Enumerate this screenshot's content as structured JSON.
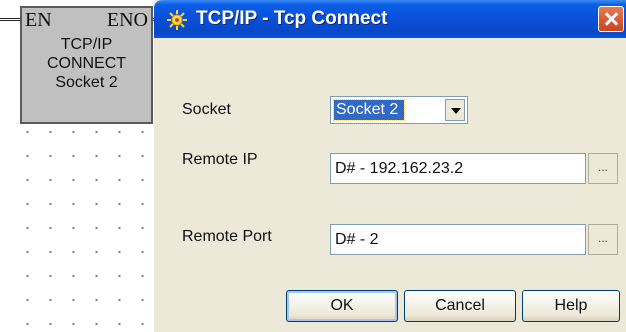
{
  "function_block": {
    "en_label": "EN",
    "eno_label": "ENO",
    "lines": [
      "TCP/IP",
      "CONNECT",
      "Socket 2"
    ]
  },
  "dialog": {
    "title": "TCP/IP - Tcp Connect",
    "icon": "sun-icon",
    "socket": {
      "label": "Socket",
      "value": "Socket 2"
    },
    "remote_ip": {
      "label": "Remote IP",
      "value": "D# - 192.162.23.2",
      "browse_label": "..."
    },
    "remote_port": {
      "label": "Remote Port",
      "value": "D# - 2",
      "browse_label": "..."
    },
    "buttons": {
      "ok": "OK",
      "cancel": "Cancel",
      "help": "Help"
    }
  },
  "colors": {
    "titlebar": "#0a4fd8",
    "dialog_bg": "#ece9d8",
    "selection": "#316ac5",
    "block_bg": "#c0c0c0",
    "close_button": "#c84418"
  }
}
